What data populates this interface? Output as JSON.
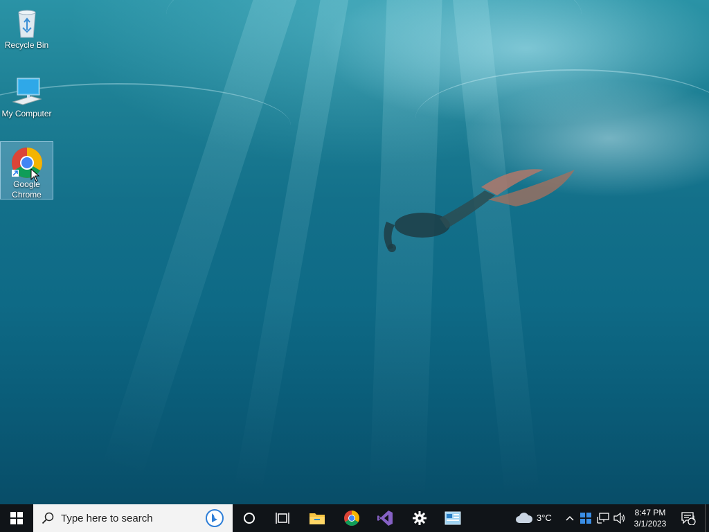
{
  "desktop": {
    "icons": [
      {
        "label": "Recycle Bin",
        "icon": "recycle-bin-icon"
      },
      {
        "label": "My Computer",
        "icon": "computer-icon"
      },
      {
        "label": "Google Chrome",
        "icon": "chrome-icon",
        "selected": true
      }
    ]
  },
  "taskbar": {
    "start_icon": "windows-start-icon",
    "search": {
      "placeholder": "Type here to search",
      "icon": "search-icon",
      "bing_icon": "bing-icon"
    },
    "apps": [
      {
        "name": "cortana",
        "icon": "cortana-circle-icon"
      },
      {
        "name": "task-view",
        "icon": "task-view-icon"
      },
      {
        "name": "file-explorer",
        "icon": "folder-icon"
      },
      {
        "name": "google-chrome",
        "icon": "chrome-icon"
      },
      {
        "name": "visual-studio",
        "icon": "visual-studio-icon"
      },
      {
        "name": "settings",
        "icon": "gear-icon"
      },
      {
        "name": "control-panel",
        "icon": "control-panel-icon"
      }
    ],
    "weather": {
      "temp": "3°C",
      "icon": "cloud-icon"
    },
    "tray": {
      "time": "8:47 PM",
      "date": "3/1/2023",
      "notifications_count": "1",
      "icons": [
        "chevron-up-icon",
        "windows-update-icon",
        "network-icon",
        "volume-icon"
      ]
    }
  },
  "colors": {
    "taskbar": "#101418",
    "search_bg": "#f3f3f3",
    "desktop": "#0e6a86"
  }
}
